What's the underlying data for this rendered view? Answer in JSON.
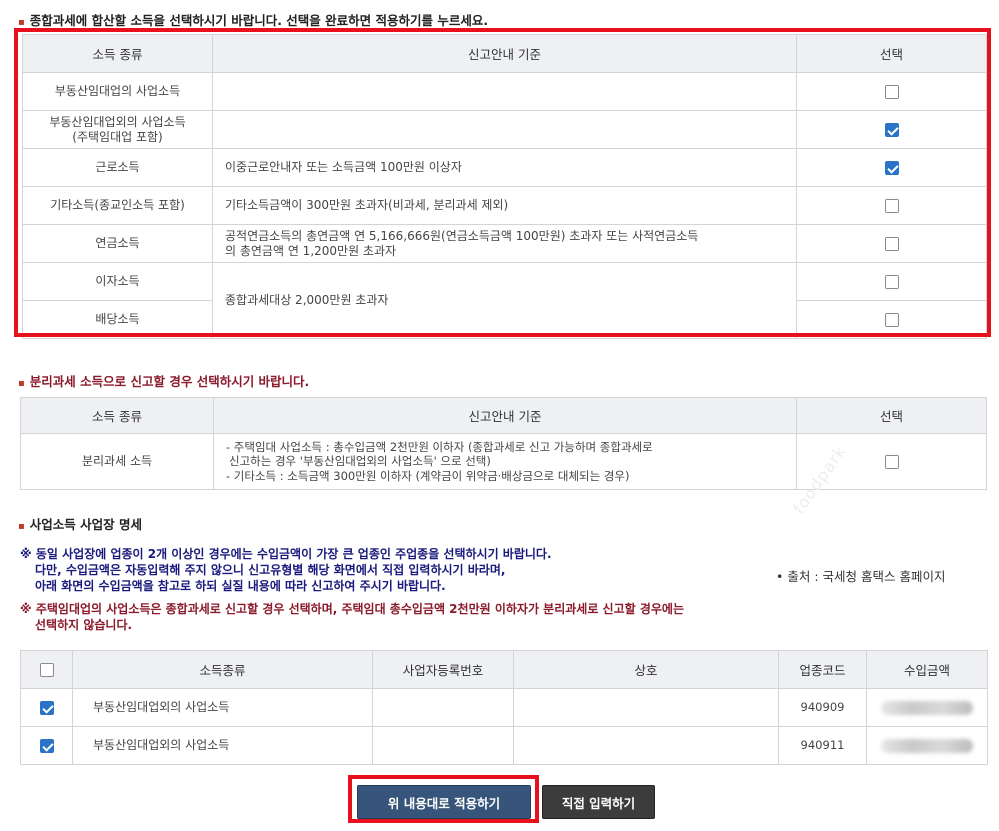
{
  "section1": {
    "title": "종합과세에 합산할 소득을 선택하시기 바랍니다. 선택을 완료하면 적용하기를 누르세요.",
    "headers": [
      "소득 종류",
      "신고안내 기준",
      "선택"
    ],
    "rows": [
      {
        "type": "부동산임대업의 사업소득",
        "criteria": "",
        "checked": false
      },
      {
        "type": "부동산임대업외의 사업소득",
        "type2": "(주택임대업 포함)",
        "criteria": "",
        "checked": true
      },
      {
        "type": "근로소득",
        "criteria": "이중근로안내자 또는 소득금액 100만원 이상자",
        "checked": true
      },
      {
        "type": "기타소득(종교인소득 포함)",
        "criteria": "기타소득금액이 300만원 초과자(비과세, 분리과세 제외)",
        "checked": false
      },
      {
        "type": "연금소득",
        "criteria": "공적연금소득의 총연금액 연 5,166,666원(연금소득금액 100만원) 초과자 또는 사적연금소득",
        "criteria2": "의 총연금액 연 1,200만원 초과자",
        "checked": false
      },
      {
        "type": "이자소득",
        "criteria": "종합과세대상 2,000만원 초과자",
        "checked": false
      },
      {
        "type": "배당소득",
        "checked": false
      }
    ]
  },
  "section2": {
    "title": "분리과세 소득으로 신고할 경우 선택하시기 바랍니다.",
    "headers": [
      "소득 종류",
      "신고안내 기준",
      "선택"
    ],
    "row": {
      "type": "분리과세 소득",
      "lines": [
        "- 주택임대 사업소득 : 총수입금액 2천만원 이하자 (종합과세로 신고 가능하며 종합과세로",
        "신고하는 경우 '부동산임대업외의 사업소득' 으로 선택)",
        "- 기타소득 : 소득금액 300만원 이하자 (계약금이 위약금·배상금으로 대체되는 경우)"
      ],
      "checked": false
    }
  },
  "section3": {
    "title": "사업소득 사업장 명세",
    "notice1": [
      "※ 동일 사업장에 업종이 2개 이상인 경우에는 수입금액이 가장 큰 업종인 주업종을 선택하시기 바랍니다.",
      "다만, 수입금액은 자동입력해 주지 않으니 신고유형별 해당 화면에서 직접 입력하시기 바라며,",
      "아래 화면의 수입금액을 참고로 하되 실질 내용에 따라 신고하여 주시기 바랍니다."
    ],
    "notice2": [
      "※ 주택임대업의 사업소득은 종합과세로 신고할 경우 선택하며, 주택임대 총수입금액 2천만원 이하자가 분리과세로 신고할 경우에는",
      "선택하지 않습니다."
    ],
    "source": "• 출처 : 국세청 홈택스 홈페이지",
    "headers": [
      "소득종류",
      "사업자등록번호",
      "상호",
      "업종코드",
      "수입금액"
    ],
    "header_checked": false,
    "rows": [
      {
        "checked": true,
        "type": "부동산임대업외의 사업소득",
        "reg_no": "",
        "name": "",
        "code": "940909"
      },
      {
        "checked": true,
        "type": "부동산임대업외의 사업소득",
        "reg_no": "",
        "name": "",
        "code": "940911"
      }
    ]
  },
  "buttons": {
    "apply": "위 내용대로 적용하기",
    "direct": "직접 입력하기"
  },
  "watermark": "foodpark",
  "colors": {
    "highlight_red": "#e8101d",
    "checkbox_blue": "#2b73c8",
    "notice_blue": "#1a1a7e",
    "notice_maroon": "#8b1a2b",
    "apply_button": "#37557a"
  }
}
